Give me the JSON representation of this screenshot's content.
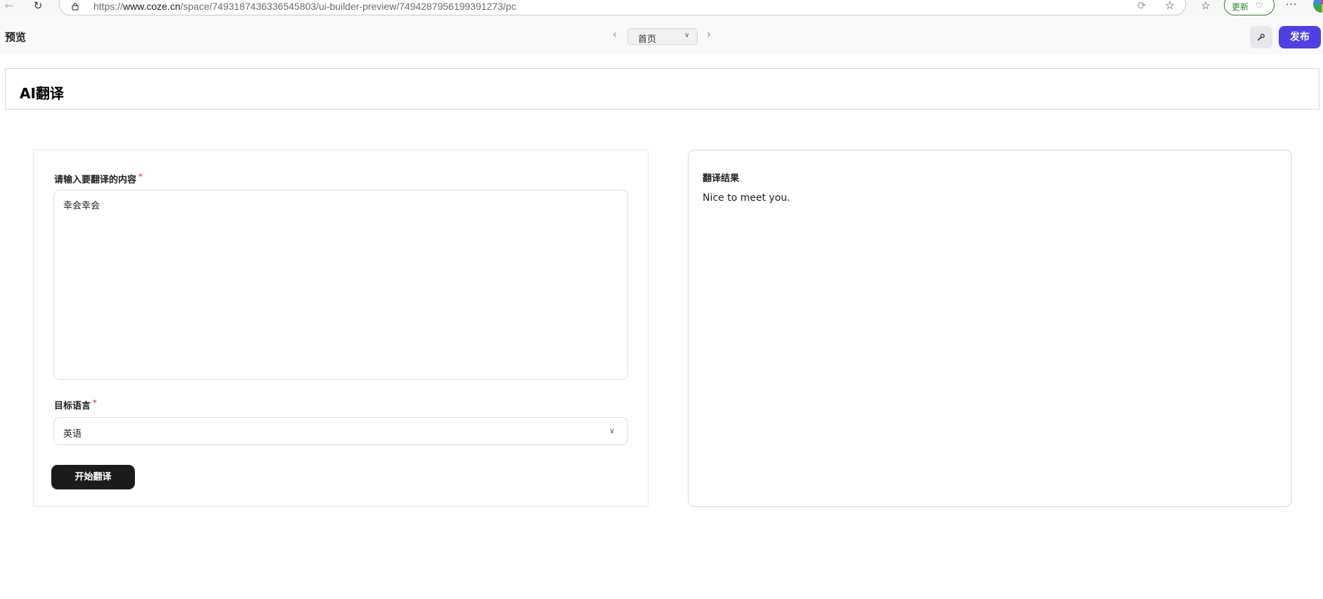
{
  "browser": {
    "url_prefix": "https://",
    "url_host": "www.coze.cn",
    "url_path": "/space/7493187436336545803/ui-builder-preview/7494287956199391273/pc",
    "update_label": "更新"
  },
  "header": {
    "title": "预览",
    "page_selector": "首页",
    "publish_label": "发布"
  },
  "app": {
    "title": "AI翻译"
  },
  "form": {
    "content_label": "请输入要翻译的内容",
    "content_value": "幸会幸会",
    "required_mark": "*",
    "language_label": "目标语言",
    "language_value": "英语",
    "submit_label": "开始翻译"
  },
  "result": {
    "title": "翻译结果",
    "text": "Nice to meet you."
  },
  "colors": {
    "publish": "#4e40e5",
    "submit": "#1b1b1b",
    "required": "#f04b4b"
  }
}
